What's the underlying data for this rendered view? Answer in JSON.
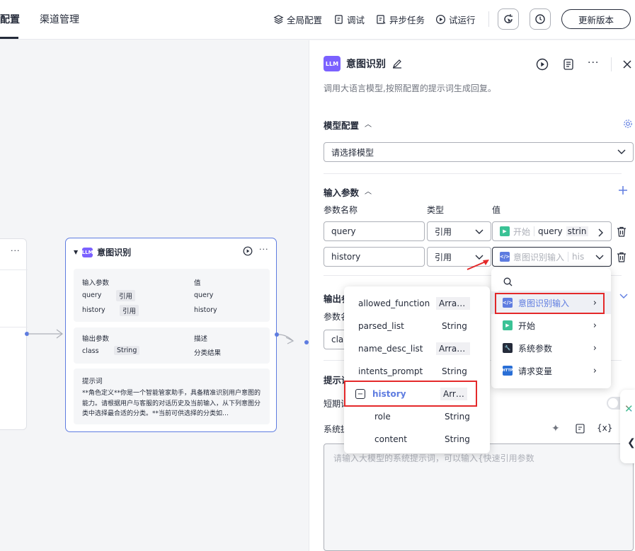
{
  "topbar": {
    "tabs": [
      "配置",
      "渠道管理"
    ],
    "buttons": {
      "global_config": "全局配置",
      "debug": "调试",
      "async_task": "异步任务",
      "trial_run": "试运行",
      "update_version": "更新版本"
    }
  },
  "node": {
    "badge": "LLM",
    "title": "意图识别",
    "input_section": {
      "col1": "输入参数",
      "col2": "值",
      "rows": [
        {
          "name": "query",
          "type": "引用",
          "value": "query"
        },
        {
          "name": "history",
          "type": "引用",
          "value": "history"
        }
      ]
    },
    "output_section": {
      "col1": "输出参数",
      "col2": "描述",
      "rows": [
        {
          "name": "class",
          "type": "String",
          "desc": "分类结果"
        }
      ]
    },
    "prompt_section": {
      "title": "提示词",
      "text": "**角色定义**你是一个智能管家助手，具备精准识别用户意图的能力。请根据用户与客服的对话历史及当前输入，从下列意图分类中选择最合适的分类。**当前可供选择的分类如…"
    }
  },
  "panel": {
    "badge": "LLM",
    "title": "意图识别",
    "description": "调用大语言模型,按照配置的提示词生成回复。",
    "model_config": {
      "label": "模型配置",
      "placeholder": "请选择模型"
    },
    "input_params": {
      "label": "输入参数",
      "col_name": "参数名称",
      "col_type": "类型",
      "col_value": "值",
      "rows": [
        {
          "name": "query",
          "type": "引用",
          "value_source": "开始",
          "value_var": "query",
          "value_type": "strin"
        },
        {
          "name": "history",
          "type": "引用",
          "value_source": "意图识别输入",
          "value_var": "his"
        }
      ]
    },
    "output_params": {
      "label": "输出参",
      "col_name": "参数名",
      "first_value": "cla"
    },
    "prompt": {
      "label": "提示词",
      "short_term": "短期记",
      "system_label": "系统提",
      "insert_var": "{x}",
      "textarea_placeholder": "请输入大模型的系统提示词，可以输入{快速引用参数"
    }
  },
  "source_dropdown": {
    "items": [
      {
        "icon": "code-icon",
        "label": "意图识别输入",
        "color": "#5e7ce0",
        "selected": true
      },
      {
        "icon": "play-icon",
        "label": "开始",
        "color": "#3ac295"
      },
      {
        "icon": "wrench-icon",
        "label": "系统参数",
        "color": "#252b3a"
      },
      {
        "icon": "http-icon",
        "label": "请求变量",
        "color": "#2a6fd6",
        "badge": "HTTP"
      }
    ]
  },
  "var_dropdown": {
    "items": [
      {
        "name": "allowed_function",
        "type": "Arra…"
      },
      {
        "name": "parsed_list",
        "type": "String"
      },
      {
        "name": "name_desc_list",
        "type": "Arra…"
      },
      {
        "name": "intents_prompt",
        "type": "String"
      },
      {
        "name": "history",
        "type": "Arr…",
        "selected": true
      },
      {
        "name": "role",
        "type": "String"
      },
      {
        "name": "content",
        "type": "String"
      }
    ]
  },
  "colors": {
    "accent": "#5e7ce0",
    "llm": "#7b61ff",
    "highlight": "#e4292a"
  }
}
